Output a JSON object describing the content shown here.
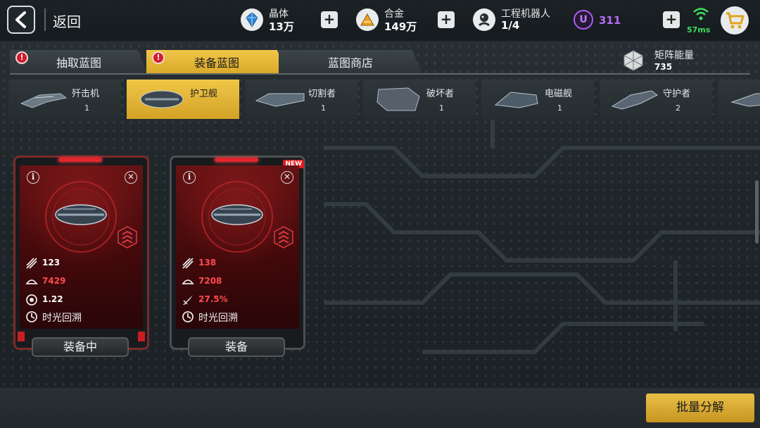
{
  "header": {
    "back_label": "返回",
    "resources": [
      {
        "name": "晶体",
        "value": "13万",
        "icon": "crystal-icon"
      },
      {
        "name": "合金",
        "value": "149万",
        "icon": "alloy-icon"
      },
      {
        "name": "工程机器人",
        "value": "1/4",
        "icon": "engineer-robot-icon"
      }
    ],
    "u_currency": {
      "letter": "U",
      "value": "311"
    },
    "ping": "57ms",
    "cart_icon": "shopping-cart-icon"
  },
  "tabs": [
    {
      "label": "抽取蓝图",
      "alert": "!"
    },
    {
      "label": "装备蓝图",
      "alert": "!",
      "active": true
    },
    {
      "label": "蓝图商店"
    }
  ],
  "matrix_energy": {
    "name": "矩阵能量",
    "value": "735"
  },
  "ship_types": [
    {
      "name": "歼击机",
      "count": "1"
    },
    {
      "name": "护卫舰",
      "count": "",
      "active": true
    },
    {
      "name": "切割者",
      "count": "1"
    },
    {
      "name": "破坏者",
      "count": "1"
    },
    {
      "name": "电磁舰",
      "count": "1"
    },
    {
      "name": "守护者",
      "count": "2"
    }
  ],
  "cards": [
    {
      "stats": [
        {
          "icon": "attack-icon",
          "value": "123",
          "highlight": false
        },
        {
          "icon": "hull-icon",
          "value": "7429",
          "highlight": true
        },
        {
          "icon": "speed-icon",
          "value": "1.22",
          "highlight": false
        }
      ],
      "skill": "时光回溯",
      "button": "装备中",
      "equipped": true,
      "new": false
    },
    {
      "stats": [
        {
          "icon": "attack-icon",
          "value": "138",
          "highlight": true
        },
        {
          "icon": "hull-icon",
          "value": "7208",
          "highlight": true
        },
        {
          "icon": "missile-icon",
          "value": "27.5%",
          "highlight": true
        }
      ],
      "skill": "时光回溯",
      "button": "装备",
      "equipped": false,
      "new": true,
      "new_label": "NEW"
    }
  ],
  "bulk_button": "批量分解",
  "colors": {
    "accent_gold": "#e9c049",
    "alert_red": "#d21c2c",
    "stat_red": "#ff4b4f",
    "purple": "#b86cf5",
    "ping_green": "#3fe05a"
  }
}
